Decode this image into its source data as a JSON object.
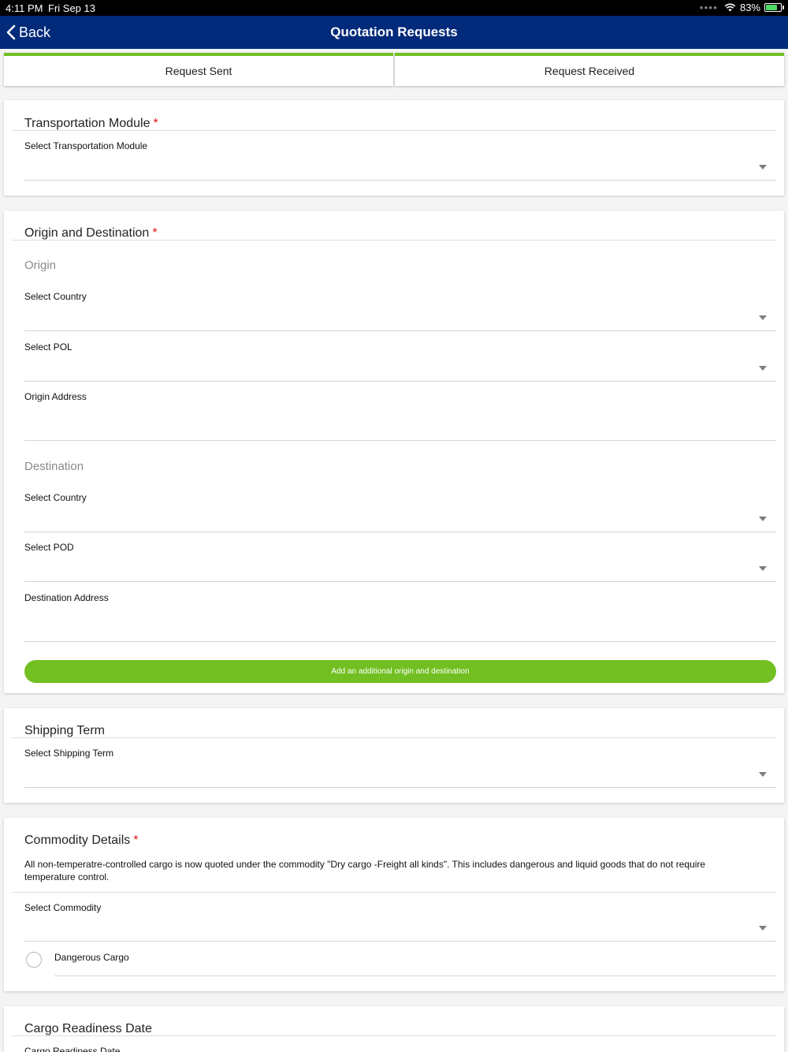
{
  "status_bar": {
    "time": "4:11 PM",
    "date": "Fri Sep 13",
    "battery_percent": "83%",
    "icons": [
      "signal-dots-icon",
      "wifi-icon",
      "battery-charging-icon"
    ]
  },
  "nav": {
    "back_label": "Back",
    "title": "Quotation Requests"
  },
  "tabs": [
    {
      "label": "Request Sent"
    },
    {
      "label": "Request Received"
    }
  ],
  "colors": {
    "nav_background": "#022a7a",
    "accent_green": "#72bf22",
    "required_red": "#e0121b"
  },
  "transportation": {
    "heading": "Transportation Module",
    "required_mark": "*",
    "select_label": "Select Transportation Module",
    "value": ""
  },
  "origin_destination": {
    "heading": "Origin and Destination",
    "required_mark": "*",
    "origin": {
      "subheading": "Origin",
      "country_label": "Select Country",
      "country_value": "",
      "pol_label": "Select POL",
      "pol_value": "",
      "address_label": "Origin Address",
      "address_value": ""
    },
    "destination": {
      "subheading": "Destination",
      "country_label": "Select Country",
      "country_value": "",
      "pod_label": "Select POD",
      "pod_value": "",
      "address_label": "Destination Address",
      "address_value": ""
    },
    "add_button": "Add an additional origin and destination"
  },
  "shipping_term": {
    "heading": "Shipping Term",
    "select_label": "Select Shipping Term",
    "value": ""
  },
  "commodity": {
    "heading": "Commodity Details",
    "required_mark": "*",
    "notice": "All non-temperatre-controlled cargo is now quoted under the commodity \"Dry cargo -Freight all kinds\". This includes dangerous and liquid goods that do not require temperature control.",
    "select_label": "Select Commodity",
    "value": "",
    "dangerous_cargo_label": "Dangerous Cargo",
    "dangerous_cargo_checked": false
  },
  "cargo_readiness": {
    "heading": "Cargo Readiness Date",
    "field_label": "Cargo Readiness Date"
  }
}
